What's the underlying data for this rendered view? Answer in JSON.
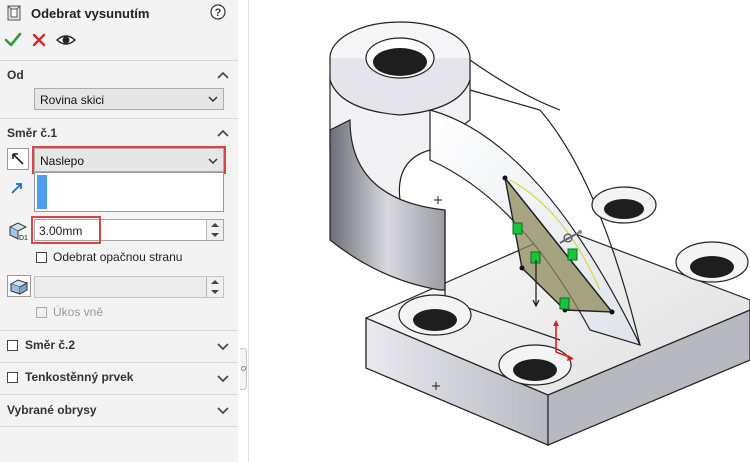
{
  "panel": {
    "title": "Odebrat vysunutím",
    "actions": {
      "ok": "check-icon",
      "cancel": "x-icon",
      "preview": "eye-icon"
    },
    "sections": {
      "from": {
        "title": "Od",
        "select_value": "Rovina skici"
      },
      "direction1": {
        "title": "Směr č.1",
        "end_condition": "Naslepo",
        "depth": "3.00mm",
        "flip_side_label": "Odebrat opačnou stranu",
        "draft_outward_label": "Úkos vně"
      },
      "direction2": {
        "title": "Směr č.2"
      },
      "thin_feature": {
        "title": "Tenkostěnný prvek"
      },
      "selected_contours": {
        "title": "Vybrané obrysy"
      }
    }
  },
  "colors": {
    "highlight": "#d9454a",
    "accent_blue": "#4a9ff0",
    "ok_green": "#2e9e3a",
    "cancel_red": "#d12b2b",
    "sketch_green": "#17c43d"
  },
  "viewport": {
    "model": "3D part with cut-extrude preview"
  }
}
